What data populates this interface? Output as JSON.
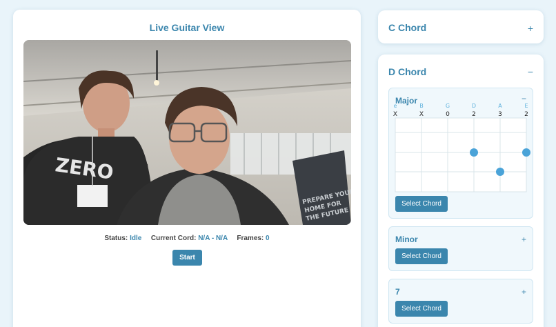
{
  "live": {
    "title": "Live Guitar View",
    "status_label": "Status:",
    "status_value": "Idle",
    "chord_label": "Current Cord:",
    "chord_value": "N/A - N/A",
    "frames_label": "Frames:",
    "frames_value": "0",
    "start_label": "Start"
  },
  "sidebar": {
    "c_chord": {
      "title": "C Chord",
      "toggle": "+"
    },
    "d_chord": {
      "title": "D Chord",
      "toggle": "−",
      "major": {
        "title": "Major",
        "toggle": "−",
        "strings": [
          "e",
          "B",
          "G",
          "D",
          "A",
          "E"
        ],
        "frets": [
          "X",
          "X",
          "0",
          "2",
          "3",
          "2"
        ],
        "select_label": "Select Chord"
      },
      "minor": {
        "title": "Minor",
        "toggle": "+",
        "select_label": "Select Chord"
      },
      "seventh": {
        "title": "7",
        "toggle": "+",
        "select_label": "Select Chord"
      }
    }
  },
  "colors": {
    "accent": "#3b86ad",
    "background": "#e9f4fa",
    "dot": "#4aa3d8"
  },
  "icons": {
    "video_placeholder": "camera-feed"
  }
}
